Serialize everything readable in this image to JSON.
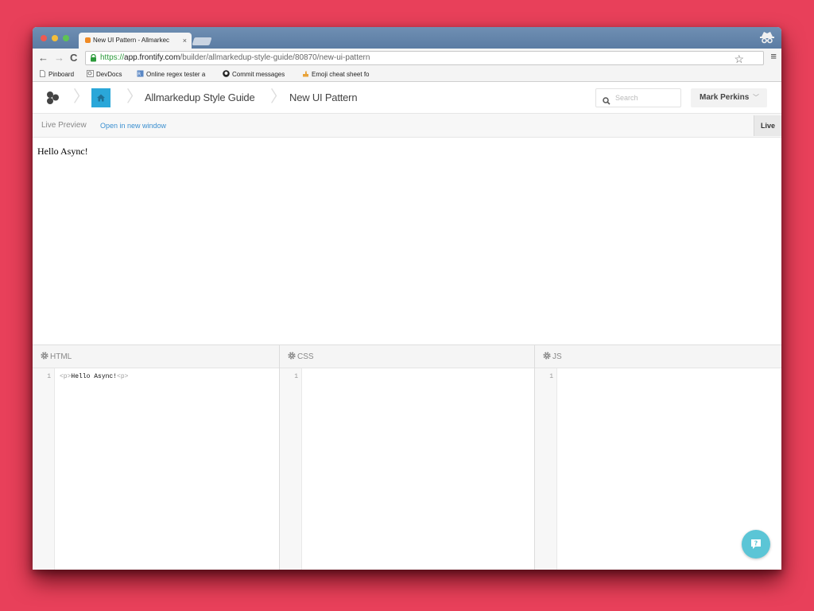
{
  "browser": {
    "tab_title": "New UI Pattern - Allmarkec",
    "tab_close": "×",
    "url_scheme": "https://",
    "url_host": "app.frontify.com",
    "url_path": "/builder/allmarkedup-style-guide/80870/new-ui-pattern",
    "bookmarks": [
      {
        "label": "Pinboard",
        "icon": "page-icon"
      },
      {
        "label": "DevDocs",
        "icon": "devdocs-icon"
      },
      {
        "label": "Online regex tester a",
        "icon": "regex-icon"
      },
      {
        "label": "Commit messages",
        "icon": "github-icon"
      },
      {
        "label": "Emoji cheat sheet fo",
        "icon": "emoji-icon"
      }
    ]
  },
  "header": {
    "project": "Allmarkedup Style Guide",
    "page": "New UI Pattern",
    "search_placeholder": "Search",
    "user": "Mark Perkins",
    "user_chevron": "﹀"
  },
  "preview": {
    "label": "Live Preview",
    "open_link": "Open in new window",
    "live_button": "Live",
    "content": "Hello Async!"
  },
  "editors": {
    "html": {
      "title": "HTML",
      "line": "1",
      "code_open": "<p>",
      "code_text": "Hello Async!",
      "code_close": "<p>"
    },
    "css": {
      "title": "CSS",
      "line": "1"
    },
    "js": {
      "title": "JS",
      "line": "1"
    }
  },
  "colors": {
    "background": "#e8405a",
    "accent": "#2aa7d9",
    "link": "#3a8fd0",
    "help_button": "#5bc5d6"
  }
}
